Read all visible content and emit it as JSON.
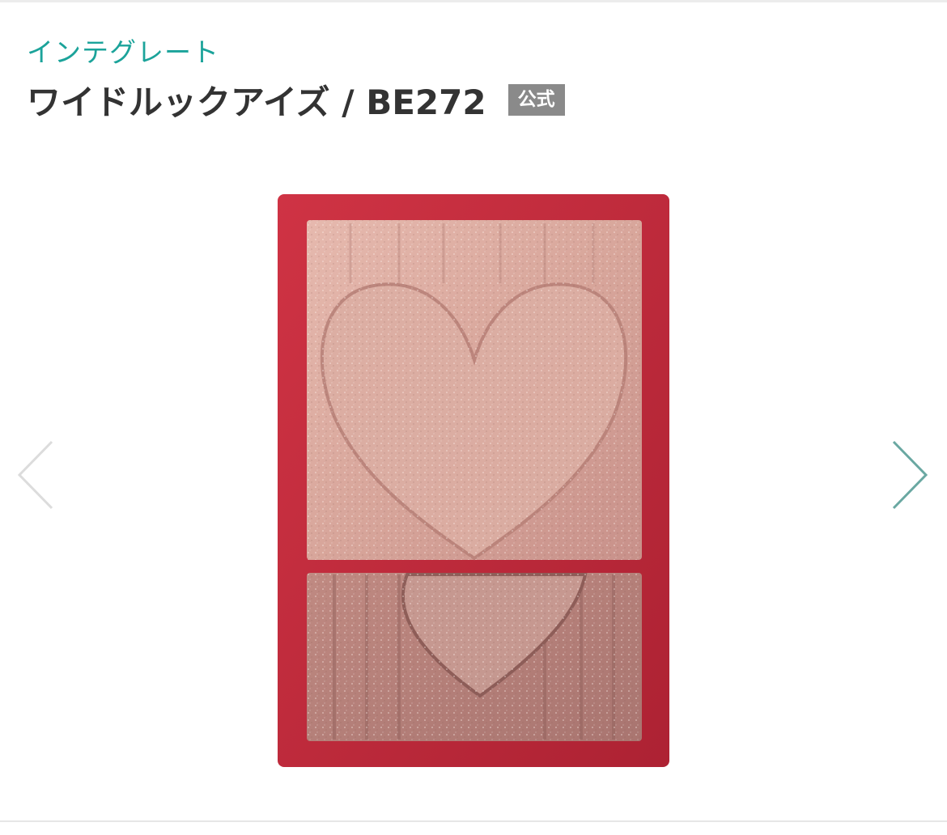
{
  "header": {
    "brand": "インテグレート",
    "product_title": "ワイドルックアイズ / BE272",
    "official_badge": "公式"
  },
  "carousel": {
    "image_alt": "ワイドルックアイズ / BE272",
    "prev_icon": "chevron-left-icon",
    "next_icon": "chevron-right-icon"
  },
  "colors": {
    "brand": "#1ba39a",
    "title": "#333333",
    "badge_bg": "#8a8a8a",
    "case_red": "#c1293a",
    "shadow_top": "#d9a49a",
    "shadow_bottom": "#b58079",
    "arrow_prev": "#dcdcdc",
    "arrow_next": "#6aa8a2"
  }
}
